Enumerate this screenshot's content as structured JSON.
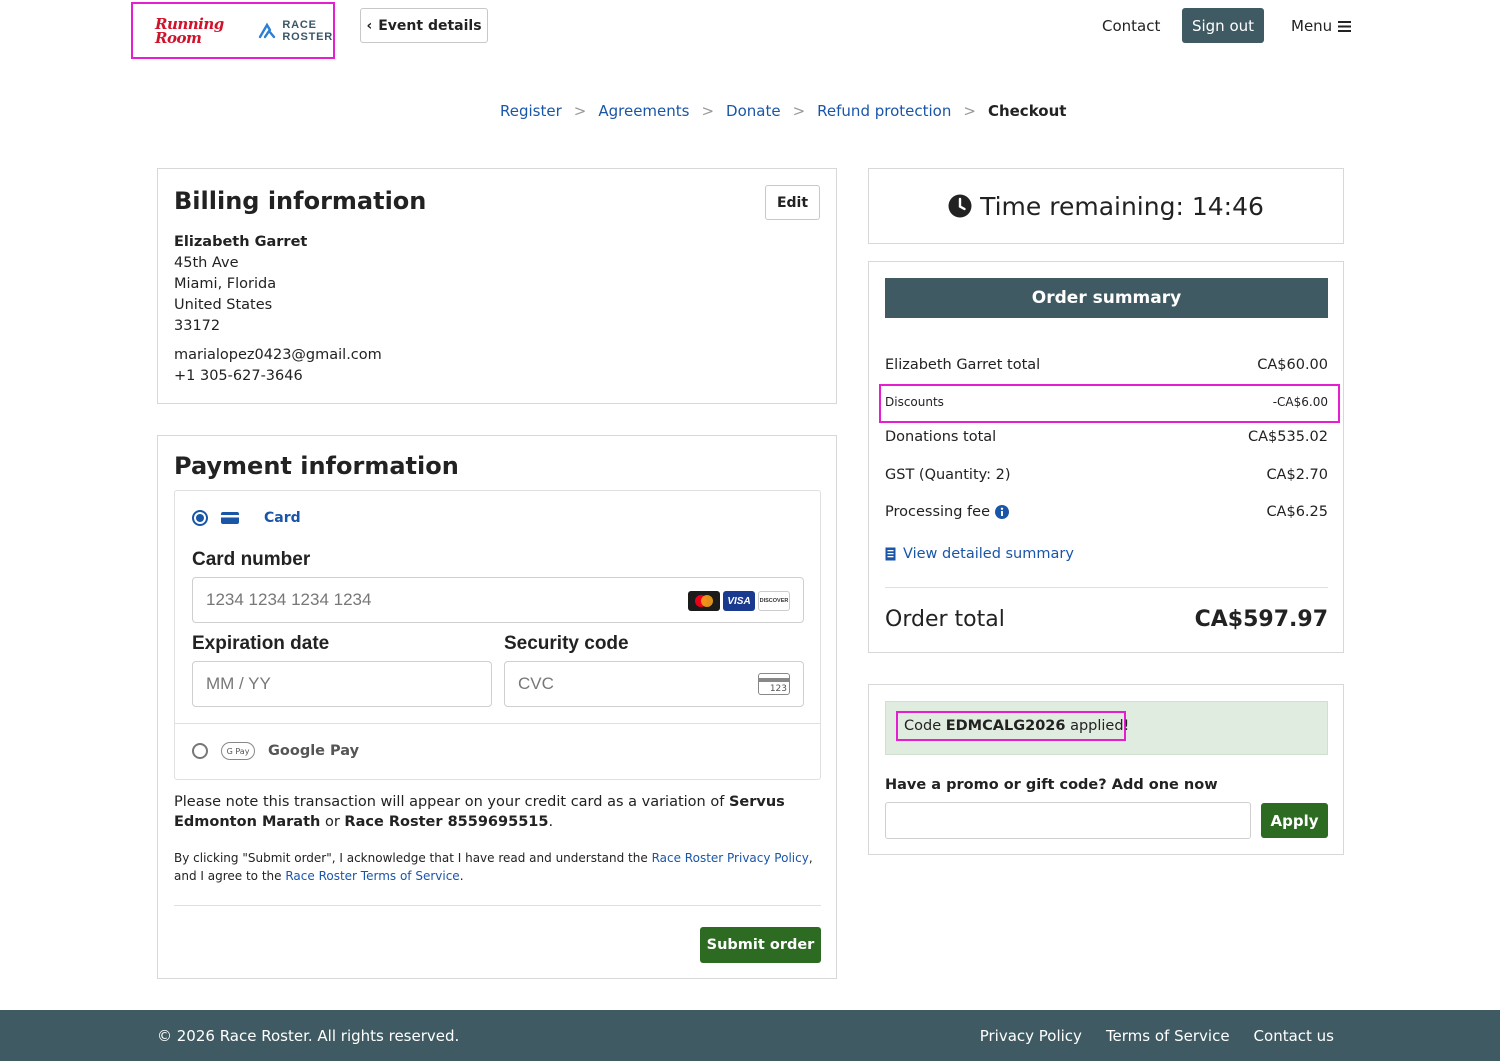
{
  "header": {
    "logo_running_room": "Running Room",
    "logo_race": "RACE",
    "logo_roster": "ROSTER",
    "event_details": "Event details",
    "contact": "Contact",
    "sign_out": "Sign out",
    "menu": "Menu"
  },
  "breadcrumb": {
    "items": [
      "Register",
      "Agreements",
      "Donate",
      "Refund protection"
    ],
    "current": "Checkout",
    "separator": ">"
  },
  "billing": {
    "title": "Billing information",
    "edit": "Edit",
    "name": "Elizabeth Garret",
    "street": "45th Ave",
    "city": "Miami, Florida",
    "country": "United States",
    "zip": "33172",
    "email": "marialopez0423@gmail.com",
    "phone": "+1 305-627-3646"
  },
  "payment": {
    "title": "Payment information",
    "method_card": "Card",
    "card_number_label": "Card number",
    "card_number_placeholder": "1234 1234 1234 1234",
    "card_brands": [
      "mastercard",
      "VISA",
      "DISCOVER"
    ],
    "exp_label": "Expiration date",
    "exp_placeholder": "MM / YY",
    "cvc_label": "Security code",
    "cvc_placeholder": "CVC",
    "cvc_icon_text": "123",
    "gpay_badge": "G Pay",
    "method_gpay": "Google Pay",
    "note_pre": "Please note this transaction will appear on your credit card as a variation of ",
    "note_bold1": "Servus Edmonton Marath",
    "note_mid": " or ",
    "note_bold2": "Race Roster 8559695515",
    "note_end": ".",
    "legal_pre": "By clicking \"Submit order\", I acknowledge that I have read and understand the ",
    "legal_link1": "Race Roster Privacy Policy",
    "legal_mid": ", and I agree to the ",
    "legal_link2": "Race Roster Terms of Service",
    "legal_end": ".",
    "submit": "Submit order"
  },
  "timer": {
    "text": "Time remaining: 14:46"
  },
  "summary": {
    "title": "Order summary",
    "rows": [
      {
        "label": "Elizabeth Garret total",
        "value": "CA$60.00"
      },
      {
        "label": "Discounts",
        "value": "-CA$6.00"
      },
      {
        "label": "Donations total",
        "value": "CA$535.02"
      },
      {
        "label": "GST (Quantity: 2)",
        "value": "CA$2.70"
      },
      {
        "label": "Processing fee",
        "value": "CA$6.25"
      }
    ],
    "view_detailed": "View detailed summary",
    "total_label": "Order total",
    "total_value": "CA$597.97"
  },
  "promo": {
    "applied_pre": "Code ",
    "applied_code": "EDMCALG2026",
    "applied_post": " applied!",
    "label": "Have a promo or gift code? Add one now",
    "input_value": "",
    "apply": "Apply"
  },
  "footer": {
    "copyright": "© 2026 Race Roster. All rights reserved.",
    "links": [
      "Privacy Policy",
      "Terms of Service",
      "Contact us"
    ]
  },
  "colors": {
    "brand_dark": "#3f5a62",
    "link_blue": "#1a56a8",
    "green_button": "#2d6a22",
    "highlight_magenta": "#e61ed2"
  }
}
